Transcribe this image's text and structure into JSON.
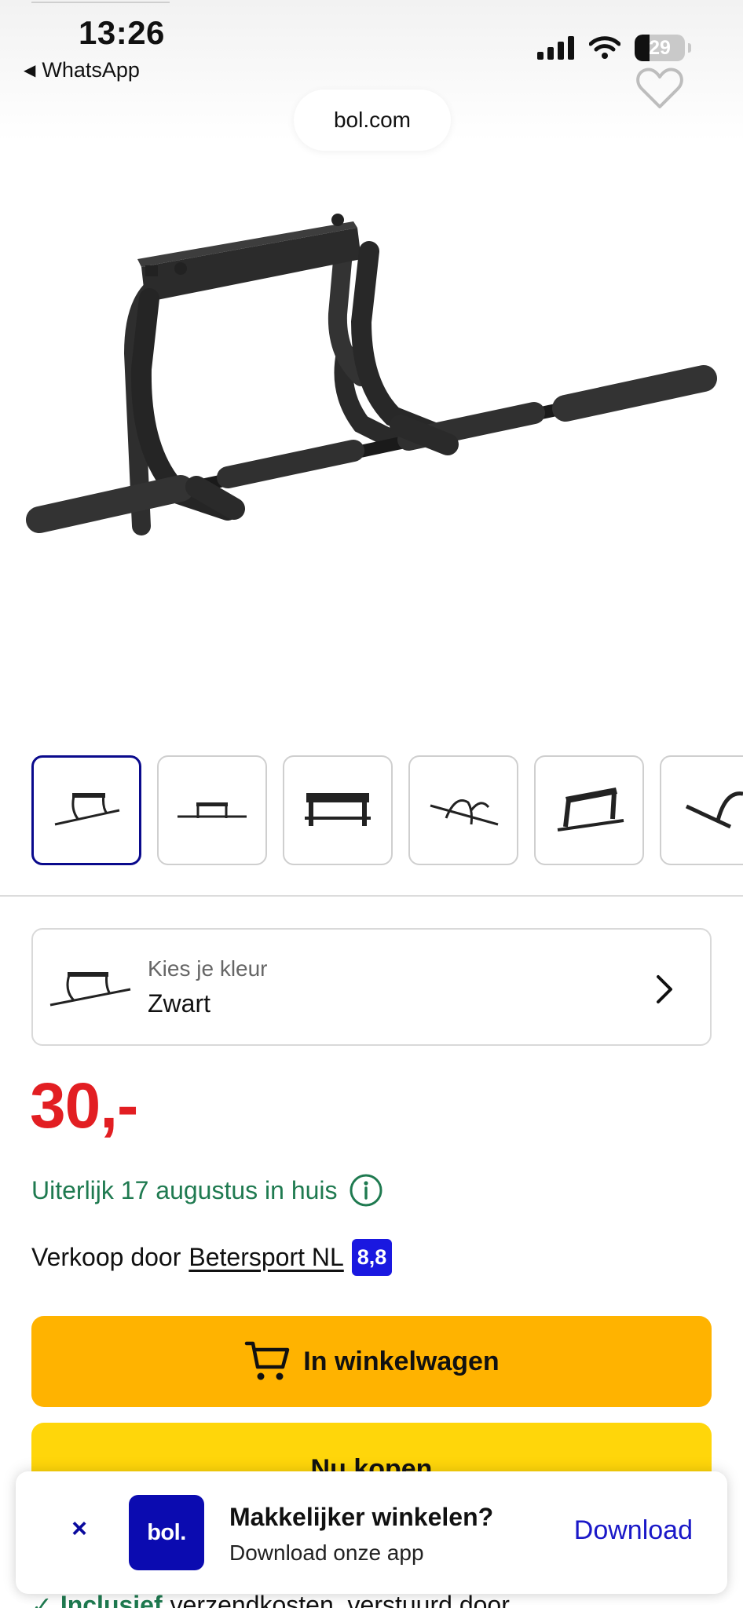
{
  "status_bar": {
    "time": "13:26",
    "back_app": "WhatsApp",
    "battery": "29",
    "battery_level": 0.29,
    "icons": [
      "cellular-signal-icon",
      "wifi-icon",
      "battery-icon"
    ]
  },
  "browser": {
    "url": "bol.com"
  },
  "product": {
    "favorite_icon": "heart-icon",
    "image_count_visible": 6,
    "color_selector": {
      "label": "Kies je kleur",
      "value": "Zwart"
    },
    "price": "30,-",
    "delivery": "Uiterlijk 17 augustus in huis",
    "seller": {
      "prefix": "Verkoop door",
      "name": "Betersport NL",
      "rating": "8,8"
    },
    "buttons": {
      "add_to_cart": "In winkelwagen",
      "buy_now": "Nu kopen"
    },
    "shipping": {
      "strong": "Inclusief",
      "rest": "verzendkosten, verstuurd door"
    }
  },
  "app_banner": {
    "close": "×",
    "logo": "bol.",
    "title": "Makkelijker winkelen?",
    "subtitle": "Download onze app",
    "download": "Download"
  },
  "colors": {
    "price": "#e21e22",
    "delivery_green": "#1f7a50",
    "rating_blue": "#1a18e0",
    "cart_button": "#ffb300",
    "buy_button": "#ffd60a",
    "bol_blue": "#0b0bb0",
    "thumb_active_border": "#0a0a8c"
  }
}
